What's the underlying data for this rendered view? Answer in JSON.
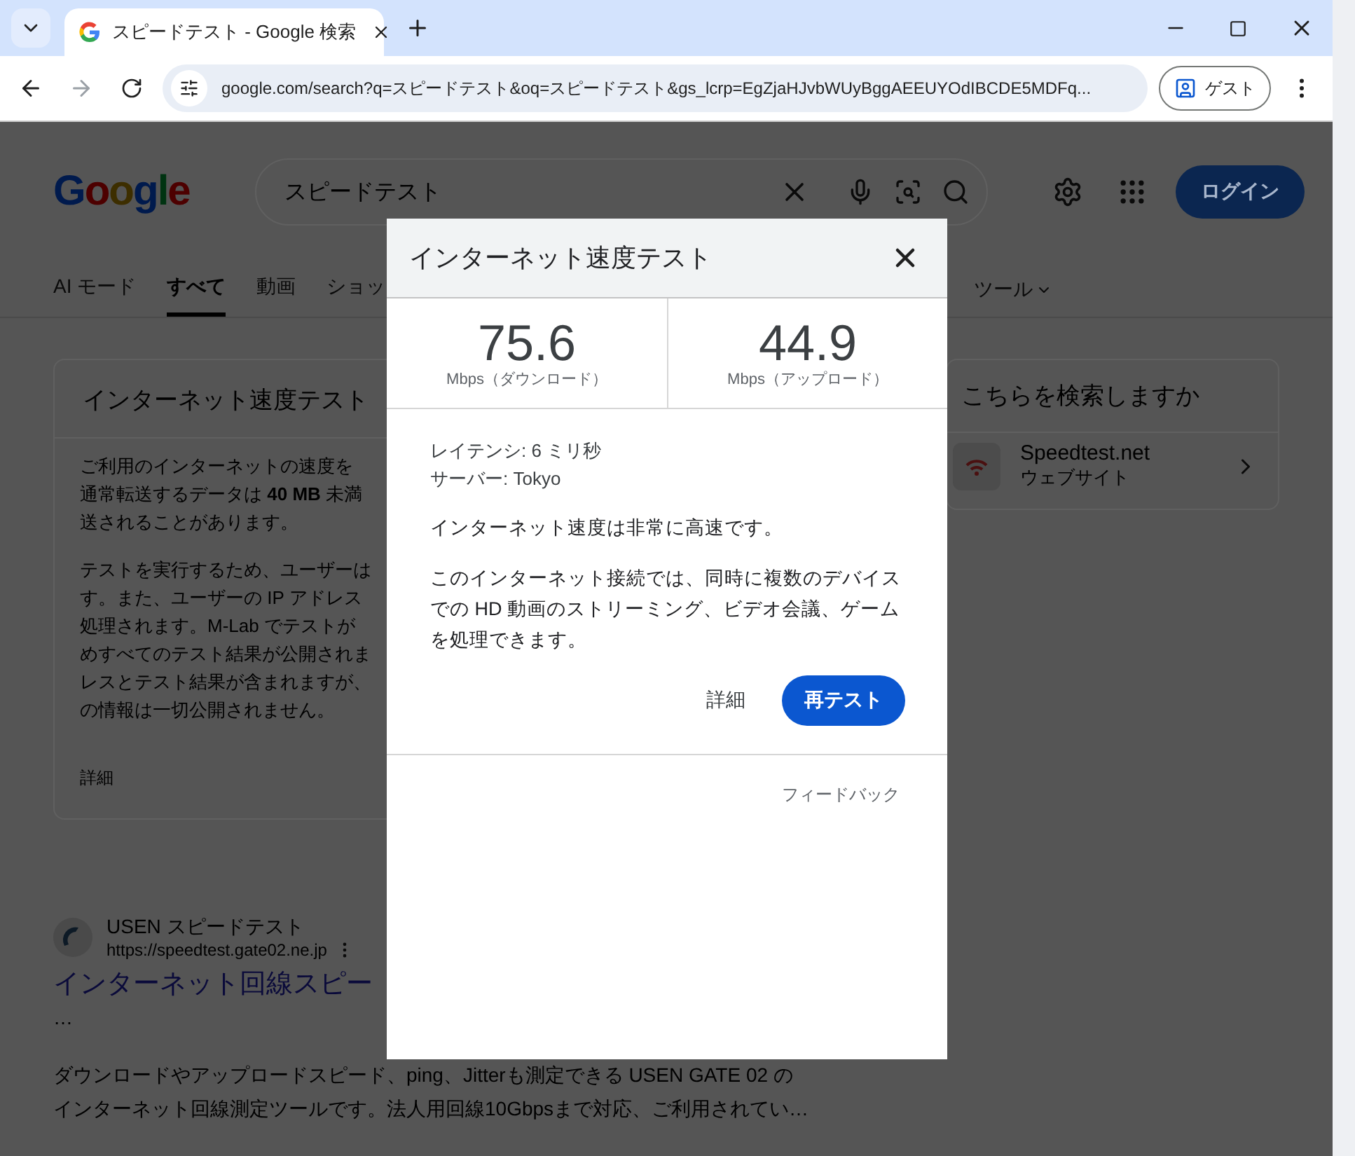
{
  "browser": {
    "tab_title": "スピードテスト - Google 検索",
    "address": "google.com/search?q=スピードテスト&oq=スピードテスト&gs_lcrp=EgZjaHJvbWUyBggAEEUYOdIBCDE5MDFq...",
    "profile_label": "ゲスト"
  },
  "page": {
    "logo": "Google",
    "search_query": "スピードテスト",
    "login_label": "ログイン",
    "tabs": [
      {
        "label": "AI モード",
        "selected": false
      },
      {
        "label": "すべて",
        "selected": true
      },
      {
        "label": "動画",
        "selected": false
      },
      {
        "label": "ショッ",
        "selected": false
      }
    ],
    "tools_label": "ツール",
    "speed_card": {
      "title": "インターネット速度テスト",
      "paragraphs": [
        [
          "ご利用のインターネットの速度を",
          "通常転送するデータは **40 MB** 未満",
          "送されることがあります。"
        ],
        [
          "テストを実行するため、ユーザーは",
          "す。また、ユーザーの IP アドレス",
          "処理されます。M-Lab でテストが",
          "めすべてのテスト結果が公開されま",
          "レスとテスト結果が含まれますが、",
          "の情報は一切公開されません。"
        ]
      ],
      "more_link": "詳細"
    },
    "suggestion": {
      "title": "こちらを検索しますか",
      "items": [
        {
          "title": "Speedtest.net",
          "subtitle": "ウェブサイト"
        }
      ]
    },
    "result": {
      "site": "USEN スピードテスト",
      "url": "https://speedtest.gate02.ne.jp",
      "title": "インターネット回線スピー",
      "ellipsis": "…",
      "snippet": [
        "ダウンロードやアップロードスピード、ping、Jitterも測定できる USEN GATE 02 の",
        "インターネット回線測定ツールです。法人用回線10Gbpsまで対応、ご利用されてい…"
      ]
    }
  },
  "dialog": {
    "title": "インターネット速度テスト",
    "speeds": [
      {
        "value": "75.6",
        "unit": "Mbps（ダウンロード）"
      },
      {
        "value": "44.9",
        "unit": "Mbps（アップロード）"
      }
    ],
    "latency": "レイテンシ: 6 ミリ秒",
    "server": "サーバー: Tokyo",
    "verdict": "インターネット速度は非常に高速です。",
    "description": "このインターネット接続では、同時に複数のデバイスでの HD 動画のストリーミング、ビデオ会議、ゲームを処理できます。",
    "details_label": "詳細",
    "retest_label": "再テスト",
    "feedback_label": "フィードバック"
  }
}
